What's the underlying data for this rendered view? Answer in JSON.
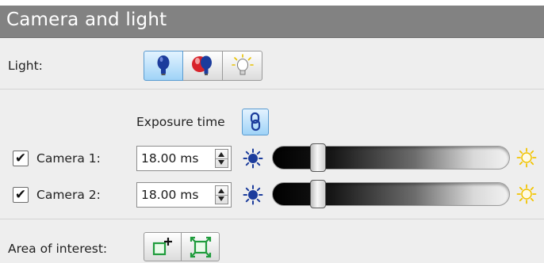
{
  "panel": {
    "title": "Camera and light"
  },
  "light": {
    "label": "Light:",
    "buttons": [
      {
        "name": "light-on",
        "icon": "blue-bulb-icon",
        "active": true
      },
      {
        "name": "light-red",
        "icon": "red-bulb-icon",
        "active": false
      },
      {
        "name": "light-off",
        "icon": "off-bulb-icon",
        "active": false
      }
    ]
  },
  "exposure": {
    "label": "Exposure time",
    "link_icon": "link-icon"
  },
  "cameras": [
    {
      "label": "Camera 1:",
      "checked": true,
      "value": "18.00 ms",
      "brightness": 0.19
    },
    {
      "label": "Camera 2:",
      "checked": true,
      "value": "18.00 ms",
      "brightness": 0.19
    }
  ],
  "aoi": {
    "label": "Area of interest:",
    "buttons": [
      {
        "icon": "add-area-icon"
      },
      {
        "icon": "fit-area-icon"
      }
    ]
  },
  "colors": {
    "header_bg": "#828282",
    "panel_bg": "#eeeeee",
    "accent_blue": "#1c3c9c",
    "icon_green": "#1f9c3c"
  }
}
